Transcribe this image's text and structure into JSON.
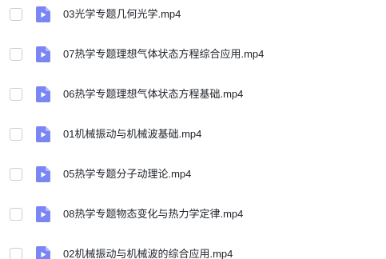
{
  "files": [
    {
      "name": "03光学专题几何光学.mp4",
      "icon": "video-file-icon",
      "checked": false
    },
    {
      "name": "07热学专题理想气体状态方程综合应用.mp4",
      "icon": "video-file-icon",
      "checked": false
    },
    {
      "name": "06热学专题理想气体状态方程基础.mp4",
      "icon": "video-file-icon",
      "checked": false
    },
    {
      "name": "01机械振动与机械波基础.mp4",
      "icon": "video-file-icon",
      "checked": false
    },
    {
      "name": "05热学专题分子动理论.mp4",
      "icon": "video-file-icon",
      "checked": false
    },
    {
      "name": "08热学专题物态变化与热力学定律.mp4",
      "icon": "video-file-icon",
      "checked": false
    },
    {
      "name": "02机械振动与机械波的综合应用.mp4",
      "icon": "video-file-icon",
      "checked": false
    }
  ],
  "colors": {
    "icon_fill": "#7b86f5",
    "icon_fold": "#b3baf9",
    "text": "#1f2329",
    "checkbox_border": "#c9cdd4"
  }
}
